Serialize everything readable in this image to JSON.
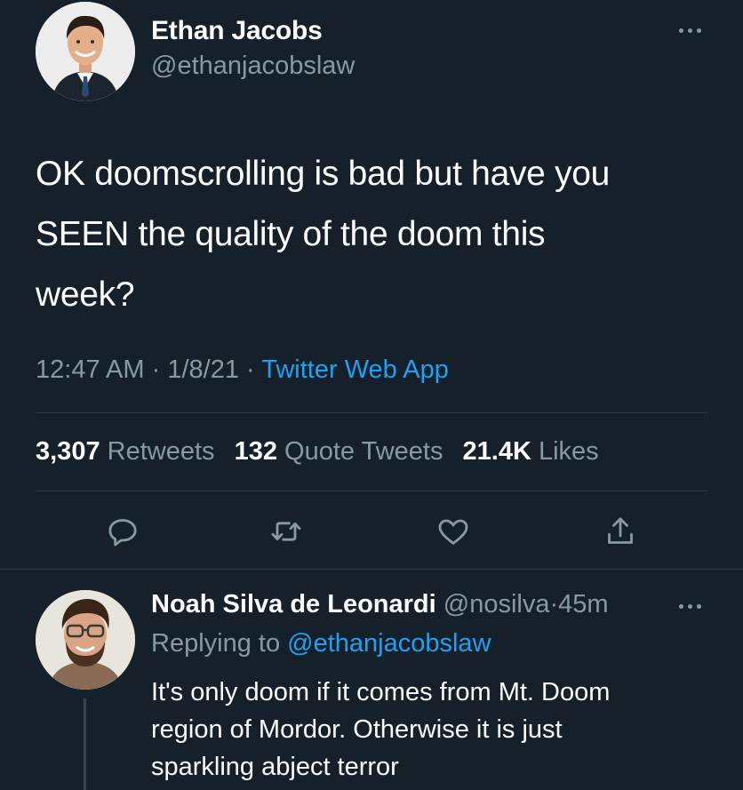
{
  "tweet": {
    "author_name": "Ethan Jacobs",
    "author_handle": "@ethanjacobslaw",
    "text": "OK doomscrolling is bad but have you\nSEEN the quality of the doom this\nweek?",
    "time": "12:47 AM",
    "date": "1/8/21",
    "separator": "·",
    "source": "Twitter Web App",
    "stats": {
      "retweets_count": "3,307",
      "retweets_label": "Retweets",
      "quotes_count": "132",
      "quotes_label": "Quote Tweets",
      "likes_count": "21.4K",
      "likes_label": "Likes"
    },
    "actions": [
      "reply-icon",
      "retweet-icon",
      "like-icon",
      "share-icon"
    ]
  },
  "reply": {
    "author_name": "Noah Silva de Leonardi",
    "author_handle": "@nosilva",
    "separator": "·",
    "time": "45m",
    "replying_prefix": "Replying to",
    "replying_to": "@ethanjacobslaw",
    "text": "It's only doom if it comes from Mt. Doom\nregion of Mordor. Otherwise it is just\nsparkling abject terror"
  },
  "colors": {
    "background": "#15202b",
    "primary_text": "#ffffff",
    "secondary_text": "#8899a6",
    "accent": "#1da1f2",
    "divider": "#2f3b47"
  }
}
